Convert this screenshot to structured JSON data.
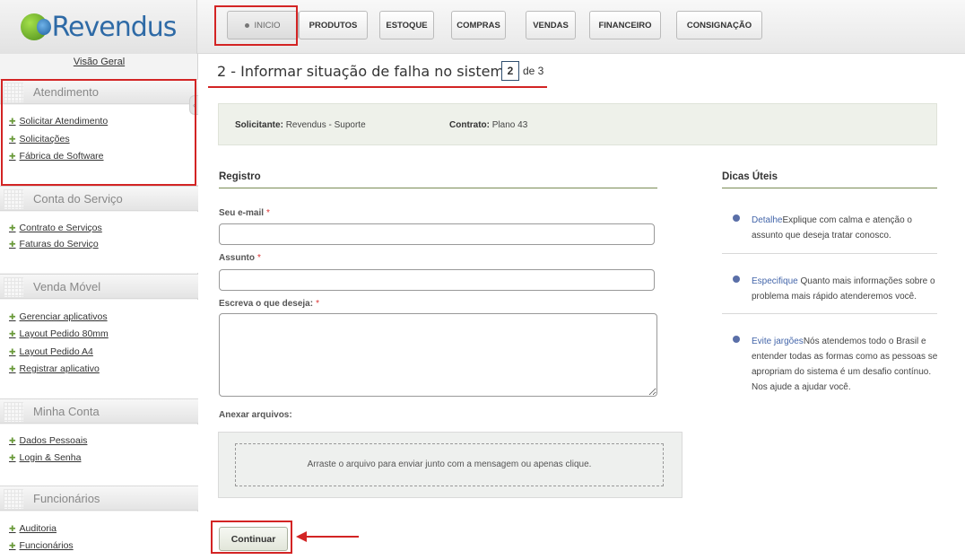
{
  "app": {
    "logo_text": "Revendus",
    "accent": "#d32424"
  },
  "topnav": {
    "items": [
      {
        "label": "INICIO",
        "active": true
      },
      {
        "label": "PRODUTOS"
      },
      {
        "label": "ESTOQUE"
      },
      {
        "label": "COMPRAS"
      },
      {
        "label": "VENDAS"
      },
      {
        "label": "FINANCEIRO"
      },
      {
        "label": "CONSIGNAÇÃO"
      }
    ]
  },
  "sidebar": {
    "overview": "Visão Geral",
    "sections": [
      {
        "title": "Atendimento",
        "links": [
          "Solicitar Atendimento",
          "Solicitações",
          "Fábrica de Software"
        ]
      },
      {
        "title": "Conta do Serviço",
        "links": [
          "Contrato e Serviços",
          "Faturas do Serviço"
        ]
      },
      {
        "title": "Venda Móvel",
        "links": [
          "Gerenciar aplicativos",
          "Layout Pedido 80mm",
          "Layout Pedido A4",
          "Registrar aplicativo"
        ]
      },
      {
        "title": "Minha Conta",
        "links": [
          "Dados Pessoais",
          "Login & Senha"
        ]
      },
      {
        "title": "Funcionários",
        "links": [
          "Auditoria",
          "Funcionários"
        ]
      }
    ]
  },
  "page": {
    "title": "2 - Informar situação de falha no sistema",
    "step_current": "2",
    "step_total": "de 3"
  },
  "info": {
    "requester_label": "Solicitante:",
    "requester_value": "Revendus - Suporte",
    "contract_label": "Contrato:",
    "contract_value": "Plano 43"
  },
  "form": {
    "section_title": "Registro",
    "email_label": "Seu e-mail",
    "subject_label": "Assunto",
    "message_label": "Escreva o que deseja:",
    "required_mark": "*",
    "email_value": "",
    "subject_value": "",
    "message_value": "",
    "attach_label": "Anexar arquivos:",
    "dropzone_text": "Arraste o arquivo para enviar junto com a mensagem ou apenas clique.",
    "continue_label": "Continuar"
  },
  "tips": {
    "title": "Dicas Úteis",
    "items": [
      {
        "key": "Detalhe",
        "text": "Explique com calma e atenção o assunto que deseja tratar conosco."
      },
      {
        "key": "Especifique",
        "text": " Quanto mais informações sobre o problema mais rápido atenderemos você."
      },
      {
        "key": "Evite jargões",
        "text": "Nós atendemos todo o Brasil e entender todas as formas como as pessoas se apropriam do sistema é um desafio contínuo. Nos ajude a ajudar você."
      }
    ]
  }
}
